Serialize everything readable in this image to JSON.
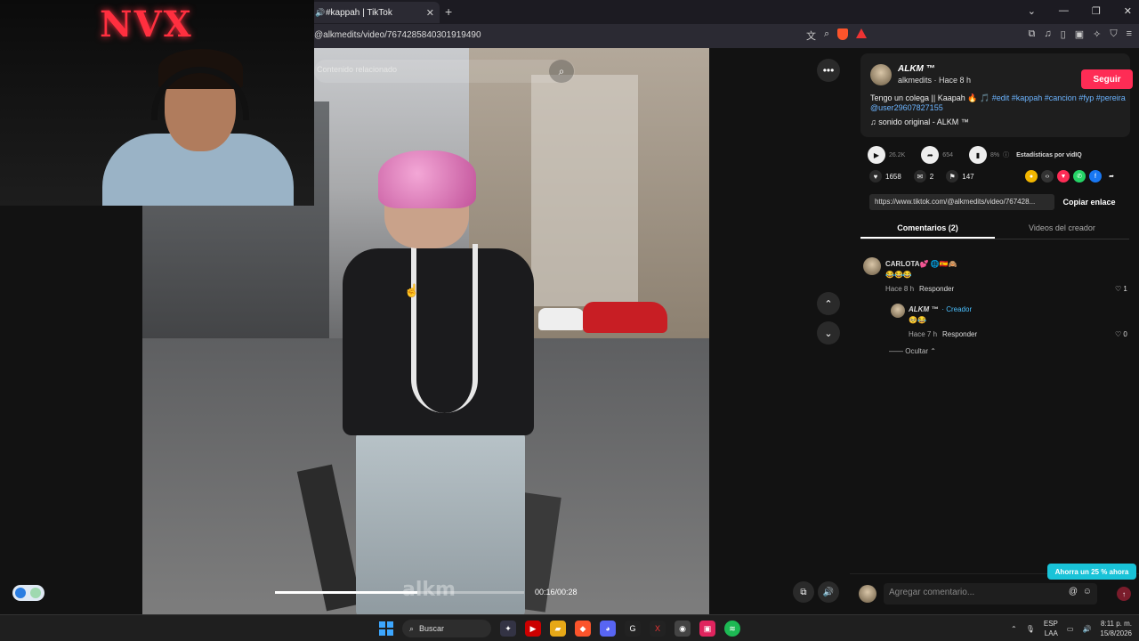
{
  "browser": {
    "tab_title": "#kappah | TikTok",
    "url": "@alkmedits/video/7674285840301919490"
  },
  "webcam": {
    "neon_text": "NVX"
  },
  "video": {
    "related_label": "Contenido relacionado",
    "watermark": "alkm",
    "time": "00:16/00:28",
    "progress": 0.57
  },
  "panel": {
    "author": "ALKM ™",
    "author_sub": "alkmedits · Hace 8 h",
    "follow_label": "Seguir",
    "description_text": "Tengo un colega || Kaapah 🔥 🎵",
    "description_tags": "#edit #kappah #cancion #fyp #pereira @user29607827155",
    "sound": "♫  sonido original - ALKM ™",
    "stats": {
      "plays": "26.2K",
      "shares": "654",
      "percent": "8%",
      "vidiq": "Estadísticas por vidIQ"
    },
    "actions": {
      "likes": "1658",
      "comments": "2",
      "saves": "147"
    },
    "link": "https://www.tiktok.com/@alkmedits/video/767428...",
    "copy_label": "Copiar enlace",
    "tabs": [
      "Comentarios (2)",
      "Videos del creador"
    ],
    "comments": [
      {
        "name": "CARLOTA💕 🌐🇪🇸🙈",
        "text": "😂😂😂",
        "time": "Hace 8 h",
        "reply": "Responder",
        "likes": "1"
      },
      {
        "name": "ALKM ™",
        "badge": "· Creador",
        "text": "🥺😂",
        "time": "Hace 7 h",
        "reply": "Responder",
        "likes": "0"
      }
    ],
    "hide_label": "Ocultar ⌃",
    "comment_placeholder": "Agregar comentario...",
    "promo": "Ahorra un 25 % ahora"
  },
  "taskbar": {
    "search": "Buscar",
    "lang": "ESP",
    "lang2": "LAA",
    "time": "8:11 p. m.",
    "date": "15/8/2026"
  },
  "colors": {
    "follow": "#fe2c55",
    "tag": "#6cb4ff",
    "promo": "#19c3d8"
  }
}
